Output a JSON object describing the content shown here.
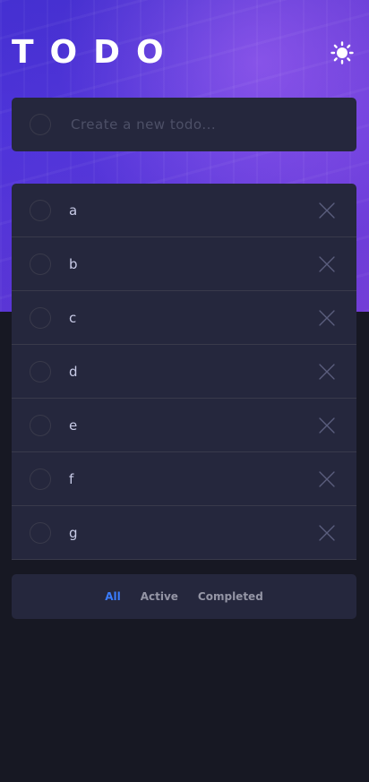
{
  "header": {
    "title": "TODO",
    "theme_icon": "sun-icon"
  },
  "new_todo": {
    "placeholder": "Create a new todo..."
  },
  "todos": [
    {
      "text": "a",
      "completed": false
    },
    {
      "text": "b",
      "completed": false
    },
    {
      "text": "c",
      "completed": false
    },
    {
      "text": "d",
      "completed": false
    },
    {
      "text": "e",
      "completed": false
    },
    {
      "text": "f",
      "completed": false
    },
    {
      "text": "g",
      "completed": false
    }
  ],
  "filters": {
    "all": "All",
    "active": "Active",
    "completed": "Completed",
    "selected": "All"
  },
  "colors": {
    "background": "#171823",
    "card": "#25273d",
    "text": "#c8cbe7",
    "muted": "#9495a5",
    "accent": "#3a7cfd",
    "divider": "#393a4b"
  }
}
